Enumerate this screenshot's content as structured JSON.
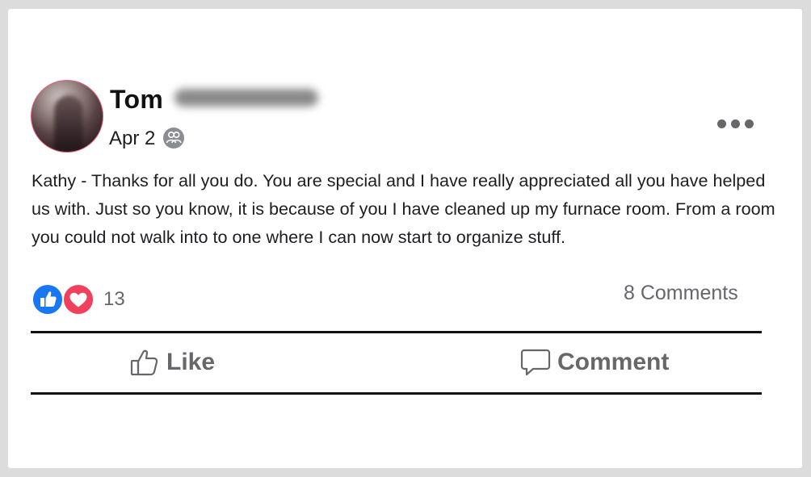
{
  "post": {
    "author": {
      "name": "Tom"
    },
    "date": "Apr 2",
    "audience_icon": "friends-icon",
    "body": "Kathy - Thanks for all you do. You are special and I have really appreciated all you have helped us with. Just so you know, it is because of you I have cleaned up my furnace room. From a room you could not walk into to one where I can now start to organize stuff.",
    "reactions": {
      "types": [
        "like",
        "love"
      ],
      "count": "13"
    },
    "comments_count": "8 Comments"
  },
  "actions": {
    "like_label": "Like",
    "comment_label": "Comment"
  },
  "colors": {
    "like_blue": "#1877f2",
    "love_red": "#f0405c",
    "secondary_text": "#65676b",
    "primary_text": "#1c1e21",
    "divider": "#111111"
  }
}
